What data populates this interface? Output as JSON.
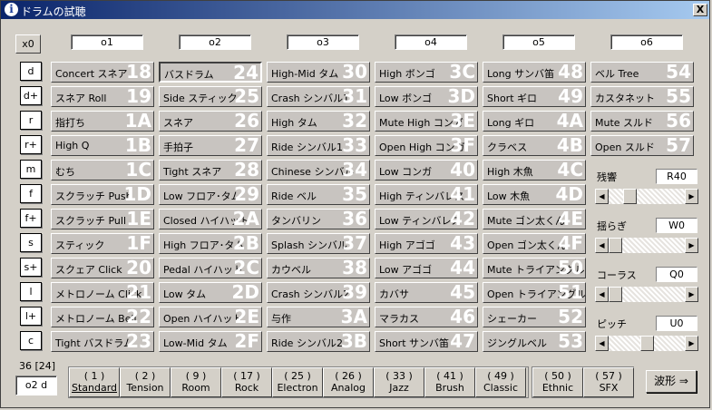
{
  "window": {
    "title": "ドラムの試聴",
    "close_glyph": "X"
  },
  "x0_label": "x0",
  "octaves": [
    "o1",
    "o2",
    "o3",
    "o4",
    "o5",
    "o6"
  ],
  "row_buttons": [
    "d",
    "d+",
    "r",
    "r+",
    "m",
    "f",
    "f+",
    "s",
    "s+",
    "l",
    "l+",
    "c"
  ],
  "instruments": [
    [
      {
        "name": "Concert スネア",
        "code": "18"
      },
      {
        "name": "スネア Roll",
        "code": "19"
      },
      {
        "name": "指打ち",
        "code": "1A"
      },
      {
        "name": "High Q",
        "code": "1B"
      },
      {
        "name": "むち",
        "code": "1C"
      },
      {
        "name": "スクラッチ Push",
        "code": "1D"
      },
      {
        "name": "スクラッチ Pull",
        "code": "1E"
      },
      {
        "name": "スティック",
        "code": "1F"
      },
      {
        "name": "スクェア Click",
        "code": "20"
      },
      {
        "name": "メトロノーム Click",
        "code": "21"
      },
      {
        "name": "メトロノーム Bell",
        "code": "22"
      },
      {
        "name": "Tight バスドラム",
        "code": "23"
      }
    ],
    [
      {
        "name": "バスドラム",
        "code": "24"
      },
      {
        "name": "Side スティック",
        "code": "25"
      },
      {
        "name": "スネア",
        "code": "26"
      },
      {
        "name": "手拍子",
        "code": "27"
      },
      {
        "name": "Tight スネア",
        "code": "28"
      },
      {
        "name": "Low フロア･タム",
        "code": "29"
      },
      {
        "name": "Closed ハイハット",
        "code": "2A"
      },
      {
        "name": "High フロア･タム",
        "code": "2B"
      },
      {
        "name": "Pedal ハイハット",
        "code": "2C"
      },
      {
        "name": "Low タム",
        "code": "2D"
      },
      {
        "name": "Open ハイハット",
        "code": "2E"
      },
      {
        "name": "Low-Mid タム",
        "code": "2F"
      }
    ],
    [
      {
        "name": "High-Mid タム",
        "code": "30"
      },
      {
        "name": "Crash シンバル1",
        "code": "31"
      },
      {
        "name": "High タム",
        "code": "32"
      },
      {
        "name": "Ride シンバル1",
        "code": "33"
      },
      {
        "name": "Chinese シンバル",
        "code": "34"
      },
      {
        "name": "Ride ベル",
        "code": "35"
      },
      {
        "name": "タンバリン",
        "code": "36"
      },
      {
        "name": "Splash シンバル",
        "code": "37"
      },
      {
        "name": "カウベル",
        "code": "38"
      },
      {
        "name": "Crash シンバル2",
        "code": "39"
      },
      {
        "name": "与作",
        "code": "3A"
      },
      {
        "name": "Ride シンバル2",
        "code": "3B"
      }
    ],
    [
      {
        "name": "High ボンゴ",
        "code": "3C"
      },
      {
        "name": "Low ボンゴ",
        "code": "3D"
      },
      {
        "name": "Mute High コンガ",
        "code": "3E"
      },
      {
        "name": "Open High コンガ",
        "code": "3F"
      },
      {
        "name": "Low コンガ",
        "code": "40"
      },
      {
        "name": "High ティンバレス",
        "code": "41"
      },
      {
        "name": "Low ティンバレス",
        "code": "42"
      },
      {
        "name": "High アゴゴ",
        "code": "43"
      },
      {
        "name": "Low アゴゴ",
        "code": "44"
      },
      {
        "name": "カバサ",
        "code": "45"
      },
      {
        "name": "マラカス",
        "code": "46"
      },
      {
        "name": "Short サンバ笛",
        "code": "47"
      }
    ],
    [
      {
        "name": "Long サンバ笛",
        "code": "48"
      },
      {
        "name": "Short ギロ",
        "code": "49"
      },
      {
        "name": "Long ギロ",
        "code": "4A"
      },
      {
        "name": "クラベス",
        "code": "4B"
      },
      {
        "name": "High 木魚",
        "code": "4C"
      },
      {
        "name": "Low 木魚",
        "code": "4D"
      },
      {
        "name": "Mute ゴン太くん",
        "code": "4E"
      },
      {
        "name": "Open ゴン太くん",
        "code": "4F"
      },
      {
        "name": "Mute トライアングル",
        "code": "50"
      },
      {
        "name": "Open トライアングル",
        "code": "51"
      },
      {
        "name": "シェーカー",
        "code": "52"
      },
      {
        "name": "ジングルベル",
        "code": "53"
      }
    ],
    [
      {
        "name": "ベル Tree",
        "code": "54"
      },
      {
        "name": "カスタネット",
        "code": "55"
      },
      {
        "name": "Mute スルド",
        "code": "56"
      },
      {
        "name": "Open スルド",
        "code": "57"
      }
    ]
  ],
  "selected_instrument": "バスドラム",
  "sliders": [
    {
      "label": "残響",
      "value": "R40",
      "level": 0.23
    },
    {
      "label": "揺らぎ",
      "value": "W0",
      "level": 0.0
    },
    {
      "label": "コーラス",
      "value": "Q0",
      "level": 0.0
    },
    {
      "label": "ピッチ",
      "value": "U0",
      "level": 0.5
    }
  ],
  "status": {
    "count": "36 [24]",
    "current": "o2 d"
  },
  "presets": [
    {
      "num": "( 1 )",
      "label": "Standard"
    },
    {
      "num": "( 2 )",
      "label": "Tension"
    },
    {
      "num": "( 9 )",
      "label": "Room"
    },
    {
      "num": "( 17 )",
      "label": "Rock"
    },
    {
      "num": "( 25 )",
      "label": "Electron"
    },
    {
      "num": "( 26 )",
      "label": "Analog"
    },
    {
      "num": "( 33 )",
      "label": "Jazz"
    },
    {
      "num": "( 41 )",
      "label": "Brush"
    },
    {
      "num": "( 49 )",
      "label": "Classic"
    },
    {
      "num": "( 50 )",
      "label": "Ethnic"
    },
    {
      "num": "( 57 )",
      "label": "SFX"
    }
  ],
  "waveform_button": "波形 ⇒"
}
